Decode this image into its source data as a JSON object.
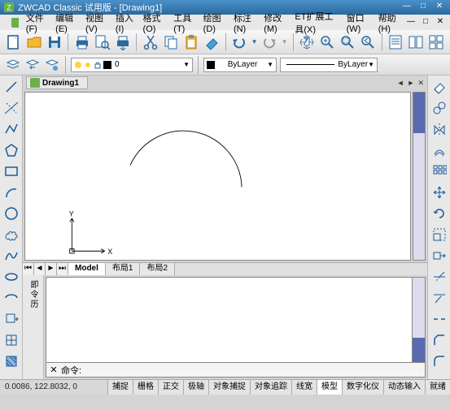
{
  "title": "ZWCAD Classic 试用版 - [Drawing1]",
  "menu": [
    "文件(F)",
    "编辑(E)",
    "视图(V)",
    "插入(I)",
    "格式(O)",
    "工具(T)",
    "绘图(D)",
    "标注(N)",
    "修改(M)",
    "ET扩展工具(X)",
    "窗口(W)",
    "帮助(H)"
  ],
  "tab_name": "Drawing1",
  "layer_combo": "0",
  "color_combo": "ByLayer",
  "linetype_combo": "ByLayer",
  "layout_tabs": [
    "Model",
    "布局1",
    "布局2"
  ],
  "cmd_prompt_label": "命令:",
  "coords": "0.0086,  122.8032,  0",
  "status_buttons": [
    "捕捉",
    "栅格",
    "正交",
    "极轴",
    "对象捕捉",
    "对象追踪",
    "线宽",
    "模型",
    "数字化仪",
    "动态输入",
    "就绪"
  ],
  "status_active_index": 7,
  "cmd_side_label": "即令历"
}
